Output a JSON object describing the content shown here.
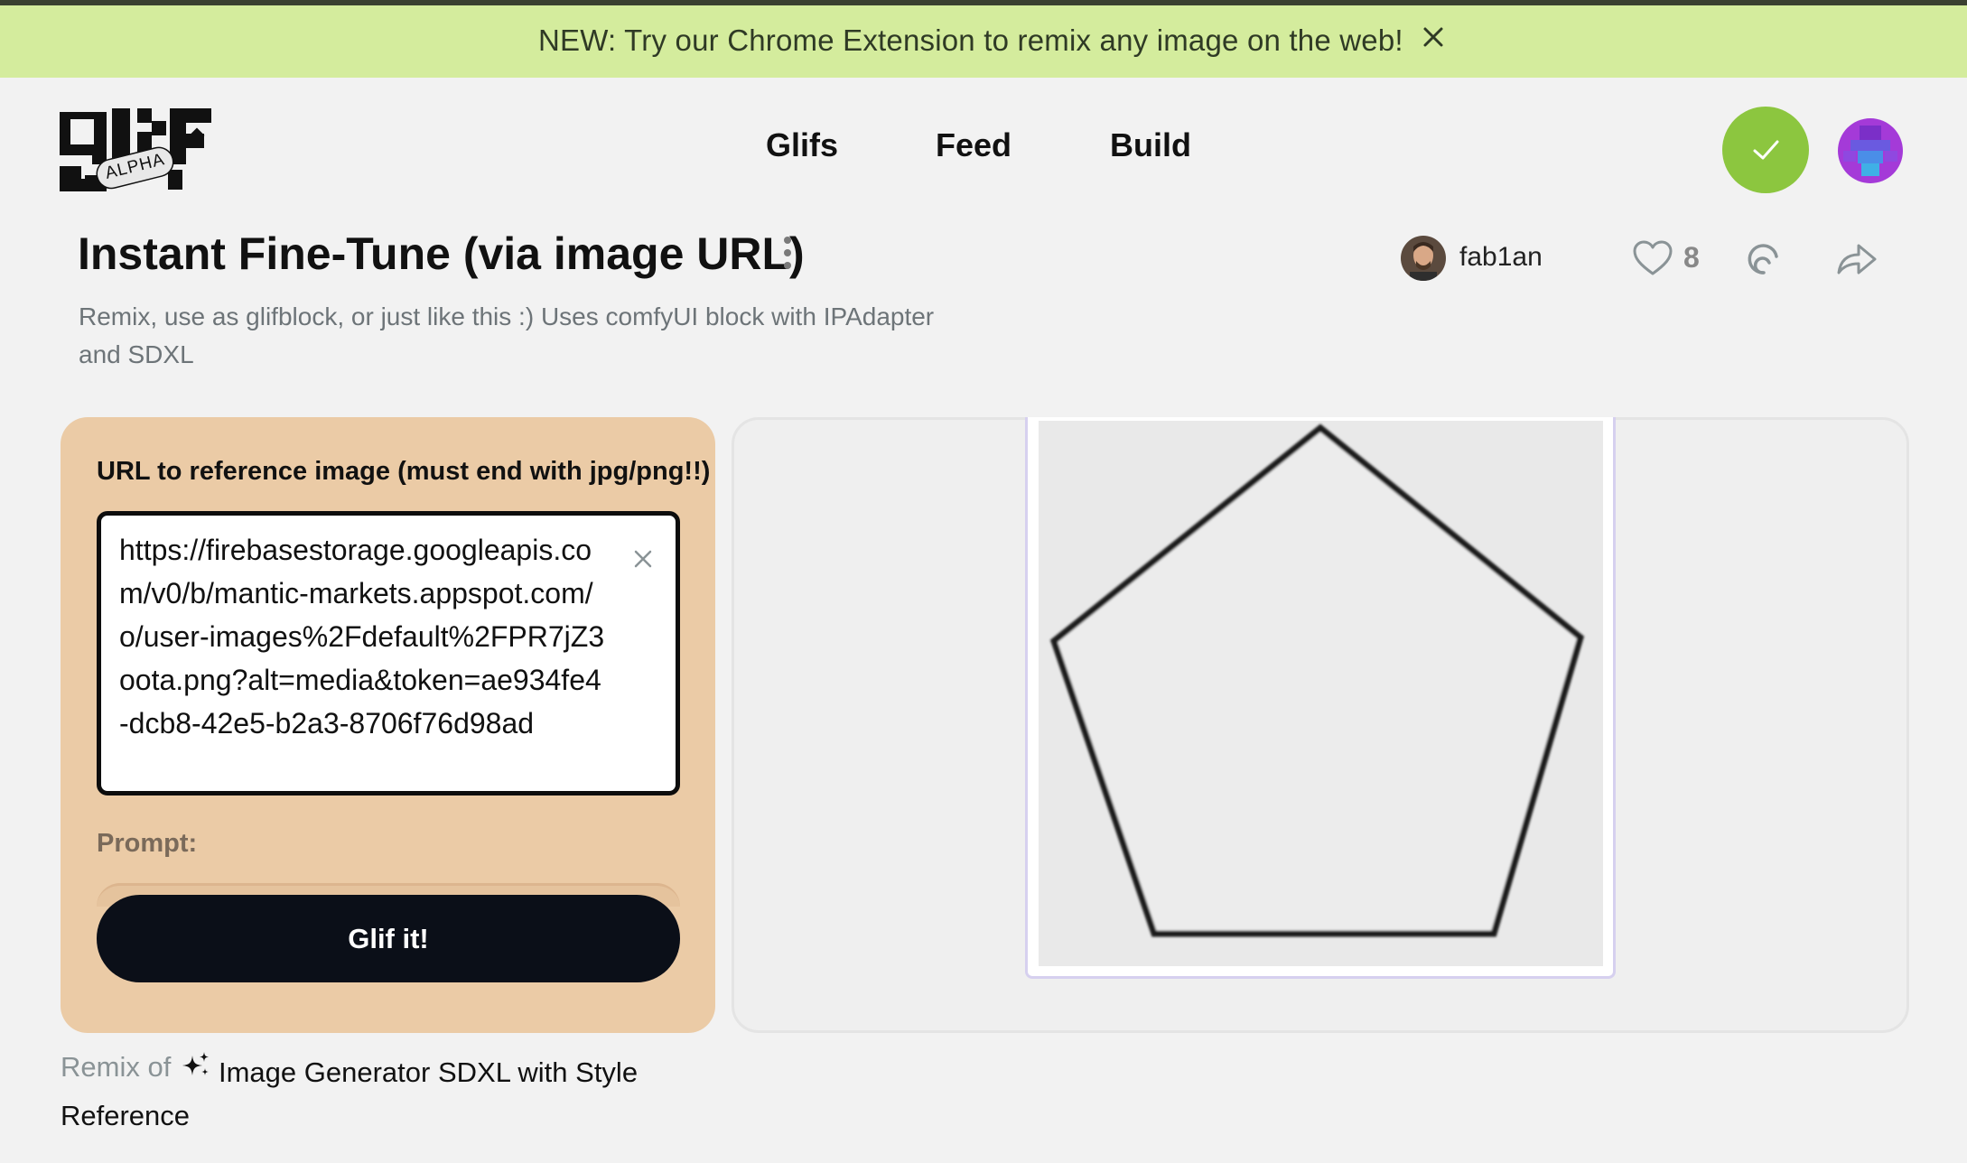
{
  "banner": {
    "text": "NEW: Try our Chrome Extension to remix any image on the web!"
  },
  "logo": {
    "badge": "ALPHA"
  },
  "nav": {
    "items": [
      {
        "label": "Glifs"
      },
      {
        "label": "Feed"
      },
      {
        "label": "Build"
      }
    ]
  },
  "header": {
    "status_color": "#8cc63f"
  },
  "glif": {
    "title": "Instant Fine-Tune (via image URL)",
    "description": "Remix, use as glifblock, or just like this :) Uses comfyUI block with IPAdapter and SDXL",
    "author": "fab1an",
    "likes": "8"
  },
  "form": {
    "url_label": "URL to reference image (must end with jpg/png!!)",
    "url_value": "https://firebasestorage.googleapis.com/v0/b/mantic-markets.appspot.com/o/user-images%2Fdefault%2FPR7jZ3oota.png?alt=media&token=ae934fe4-dcb8-42e5-b2a3-8706f76d98ad",
    "prompt_label": "Prompt:",
    "submit_label": "Glif it!"
  },
  "remix": {
    "prefix": "Remix of",
    "source": "Image Generator SDXL with Style Reference"
  },
  "colors": {
    "banner_bg": "#d4ec9d",
    "panel_bg": "#ebcba6",
    "button_bg": "#0b0f18"
  }
}
